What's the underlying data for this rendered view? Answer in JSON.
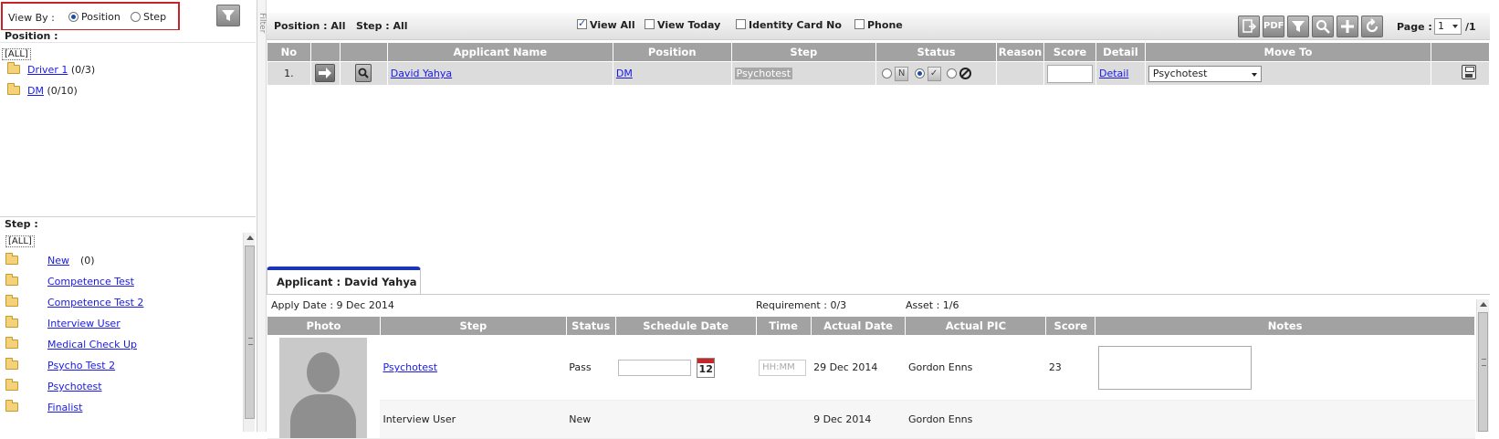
{
  "left": {
    "viewby_label": "View By :",
    "viewby_options": [
      "Position",
      "Step"
    ],
    "viewby_selected": "Position",
    "position_title": "Position :",
    "all_label": "[ALL]",
    "positions": [
      {
        "name": "Driver 1",
        "count": "(0/3)"
      },
      {
        "name": "DM",
        "count": "(0/10)"
      }
    ],
    "step_title": "Step :",
    "steps": [
      {
        "name": "New",
        "count": "(0)"
      },
      {
        "name": "Competence Test",
        "count": ""
      },
      {
        "name": "Competence Test 2",
        "count": ""
      },
      {
        "name": "Interview User",
        "count": ""
      },
      {
        "name": "Medical Check Up",
        "count": ""
      },
      {
        "name": "Psycho Test 2",
        "count": ""
      },
      {
        "name": "Psychotest",
        "count": ""
      },
      {
        "name": "Finalist",
        "count": ""
      }
    ]
  },
  "filter_tab_label": "Filter",
  "toolbar": {
    "status": "Position : All   Step : All",
    "view_all": "View All",
    "view_today": "View Today",
    "identity_card": "Identity Card No",
    "phone": "Phone",
    "view_all_checked": true,
    "page_label": "Page :",
    "page_value": "1",
    "page_total": "/1",
    "pdf_label": "PDF",
    "icons": [
      "export-icon",
      "pdf-icon",
      "filter-icon",
      "search-icon",
      "add-icon",
      "refresh-icon"
    ]
  },
  "applicants": {
    "headers": [
      "No",
      "",
      "",
      "Applicant Name",
      "Position",
      "Step",
      "Status",
      "Reason",
      "Score",
      "Detail",
      "Move To",
      ""
    ],
    "rows": [
      {
        "no": "1.",
        "name": "David Yahya",
        "position": "DM",
        "step": "Psychotest",
        "status_n": "N",
        "reason": "",
        "score": "",
        "detail": "Detail",
        "move_to": "Psychotest"
      }
    ]
  },
  "detail": {
    "tab_label": "Applicant : David Yahya",
    "apply_date": "Apply Date : 9 Dec 2014",
    "requirement": "Requirement : 0/3",
    "asset": "Asset : 1/6",
    "headers": [
      "Photo",
      "Step",
      "Status",
      "Schedule Date",
      "Time",
      "Actual Date",
      "Actual PIC",
      "Score",
      "Notes"
    ],
    "calendar_day": "12",
    "time_placeholder": "HH:MM",
    "rows": [
      {
        "step": "Psychotest",
        "status": "Pass",
        "actual_date": "29 Dec 2014",
        "actual_pic": "Gordon Enns",
        "score": "23"
      },
      {
        "step": "Interview User",
        "status": "New",
        "actual_date": "9 Dec 2014",
        "actual_pic": "Gordon Enns",
        "score": ""
      }
    ]
  },
  "colors": {
    "highlight_border": "#c9232a",
    "header_bg": "#a2a2a2",
    "tab_accent": "#1a35b5",
    "link": "#1a1ae6"
  }
}
